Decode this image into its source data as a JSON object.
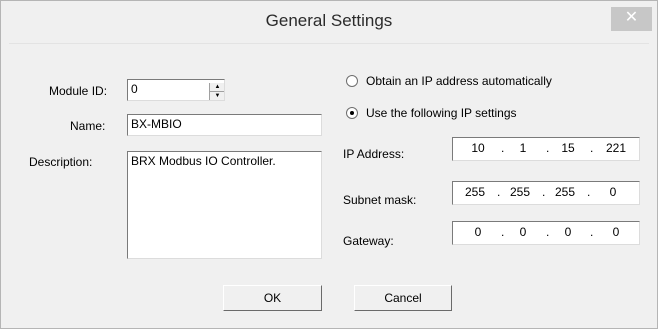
{
  "window": {
    "title": "General Settings",
    "close_glyph": "✕"
  },
  "left": {
    "module_id_label": "Module ID:",
    "module_id_value": "0",
    "name_label": "Name:",
    "name_value": "BX-MBIO",
    "description_label": "Description:",
    "description_value": "BRX Modbus IO Controller."
  },
  "right": {
    "radio_auto_label": "Obtain an IP address automatically",
    "radio_auto_selected": false,
    "radio_manual_label": "Use the following IP settings",
    "radio_manual_selected": true,
    "ip_label": "IP Address:",
    "ip": [
      "10",
      "1",
      "15",
      "221"
    ],
    "subnet_label": "Subnet mask:",
    "subnet": [
      "255",
      "255",
      "255",
      "0"
    ],
    "gateway_label": "Gateway:",
    "gateway": [
      "0",
      "0",
      "0",
      "0"
    ]
  },
  "buttons": {
    "ok": "OK",
    "cancel": "Cancel"
  }
}
